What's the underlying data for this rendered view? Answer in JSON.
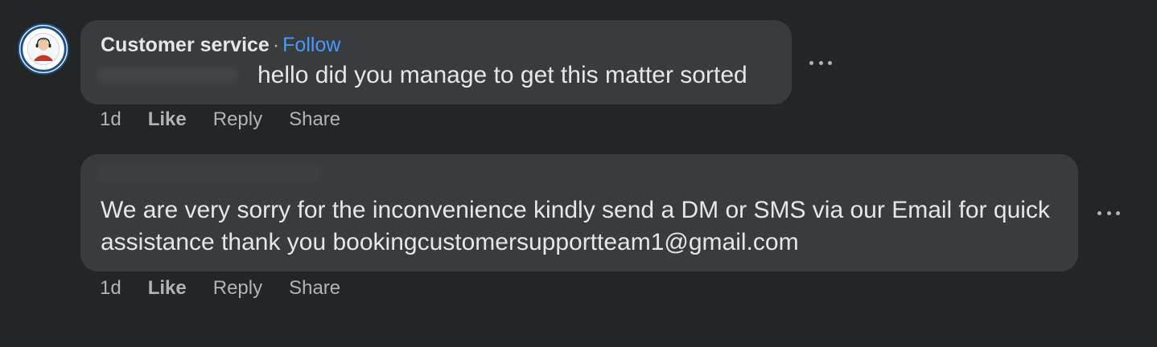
{
  "comments": [
    {
      "author": "Customer service",
      "separator": "·",
      "follow_label": "Follow",
      "text": "hello did you manage to get this matter sorted",
      "time": "1d",
      "like_label": "Like",
      "reply_label": "Reply",
      "share_label": "Share",
      "more_icon": "more-horizontal-icon"
    },
    {
      "text": "We are very sorry for the inconvenience kindly send a DM or SMS via our Email for quick assistance thank you bookingcustomersupportteam1@gmail.com",
      "time": "1d",
      "like_label": "Like",
      "reply_label": "Reply",
      "share_label": "Share",
      "more_icon": "more-horizontal-icon"
    }
  ],
  "theme": {
    "background": "#242526",
    "bubble": "#3a3b3c",
    "text_primary": "#e4e6eb",
    "text_secondary": "#b0b3b8",
    "link": "#4599ff"
  }
}
